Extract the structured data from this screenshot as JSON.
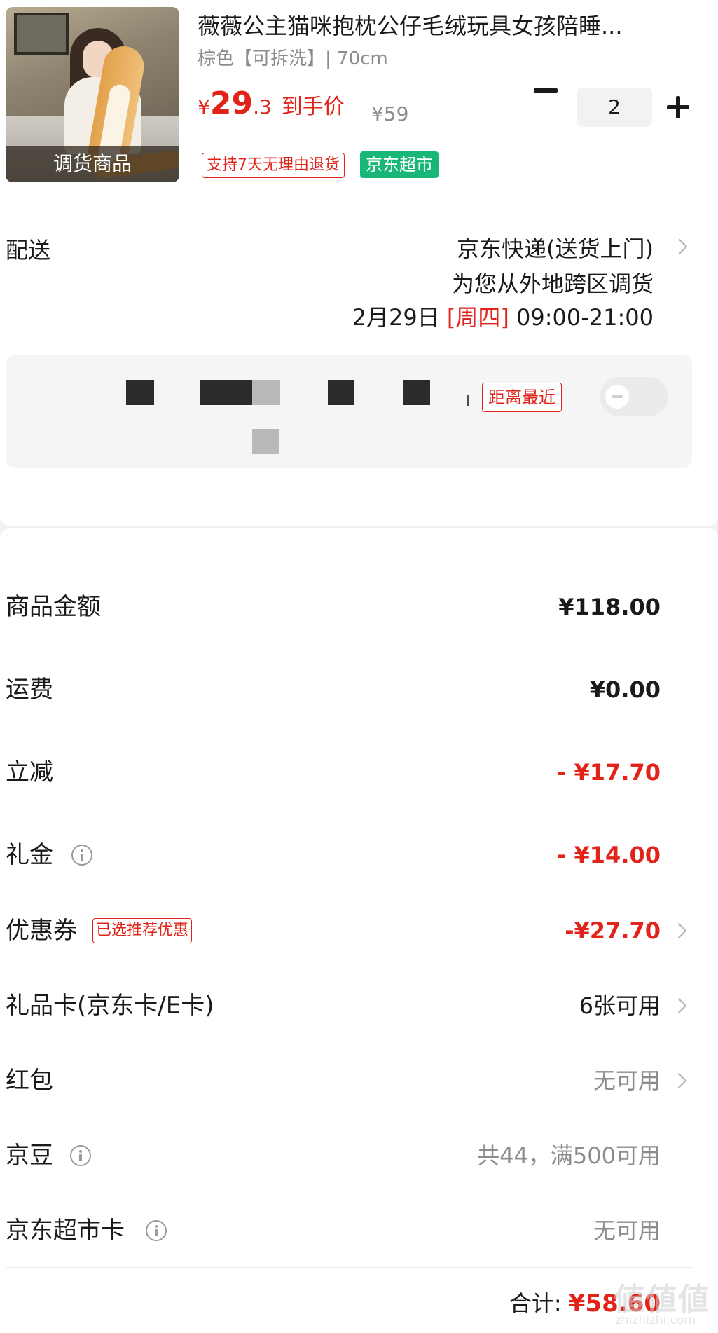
{
  "product": {
    "thumb_label": "调货商品",
    "title": "薇薇公主猫咪抱枕公仔毛绒玩具女孩陪睡...",
    "spec": "棕色【可拆洗】| 70cm",
    "price_currency": "¥",
    "price_int": "29",
    "price_dec": ".3",
    "price_tag": "到手价",
    "original_price": "¥59",
    "quantity": "2",
    "badge_return": "支持7天无理由退货",
    "badge_market": "京东超市"
  },
  "delivery": {
    "label": "配送",
    "method": "京东快递(送货上门)",
    "note": "为您从外地跨区调货",
    "time_date": "2月29日",
    "time_weekday": "[周四]",
    "time_range": "09:00-21:00"
  },
  "pickup": {
    "tag": "距离最近"
  },
  "fees": [
    {
      "label": "商品金额",
      "value": "¥118.00"
    },
    {
      "label": "运费",
      "value": "¥0.00"
    },
    {
      "label": "立减",
      "value": "- ¥17.70"
    },
    {
      "label": "礼金",
      "value": "- ¥14.00"
    },
    {
      "label": "优惠券",
      "tag": "已选推荐优惠",
      "value": "-¥27.70"
    },
    {
      "label": "礼品卡(京东卡/E卡)",
      "value": "6张可用"
    },
    {
      "label": "红包",
      "value": "无可用"
    },
    {
      "label": "京豆",
      "value": "共44，满500可用"
    },
    {
      "label": "京东超市卡",
      "value": "无可用"
    }
  ],
  "total": {
    "label": "合计:",
    "value": "¥58.60"
  },
  "watermark": {
    "big": "値値値",
    "small": "zhizhizhi.com"
  },
  "colors": {
    "accent_red": "#e2231a",
    "market_green": "#18b777",
    "muted_gray": "#8c8c8c"
  },
  "icons": {
    "info": "info-icon",
    "chevron": "chevron-right-icon",
    "minus": "minus-icon",
    "plus": "plus-icon"
  }
}
